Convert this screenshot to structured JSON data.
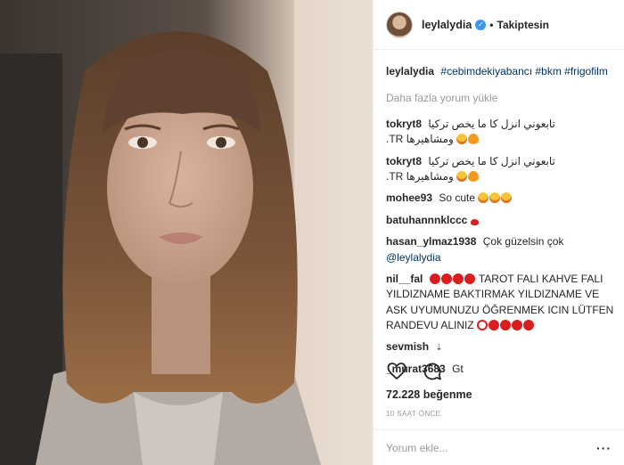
{
  "header": {
    "username": "leylalydia",
    "separator": "•",
    "follow_status": "Takiptesin"
  },
  "caption": {
    "username": "leylalydia",
    "hashtags": [
      "#cebimdekiyabancı",
      "#bkm",
      "#frigofilm"
    ]
  },
  "load_more": "Daha fazla yorum yükle",
  "comments": [
    {
      "user": "tokryt8",
      "text": "تابعوني انزل كا ما يخص تركيا",
      "text2": ".TR ومشاهيرها"
    },
    {
      "user": "tokryt8",
      "text": "تابعوني انزل كا ما يخص تركيا",
      "text2": ".TR ومشاهيرها"
    },
    {
      "user": "mohee93",
      "text": "So cute"
    },
    {
      "user": "batuhannnklccc",
      "text": ""
    },
    {
      "user": "hasan_ylmaz1938",
      "text": "Çok güzelsin çok",
      "mention": "@leylalydia"
    },
    {
      "user": "nil__fal",
      "text": "TAROT FALI KAHVE FALI YILDIZNAME BAKTIRMAK YILDIZNAME VE ASK UYUMUNUZU ÖĞRENMEK ICIN LÜTFEN RANDEVU ALINIZ"
    },
    {
      "user": "sevmish",
      "text": ""
    },
    {
      "user": "_murat3683",
      "text": "Gt"
    }
  ],
  "likes_text": "72.228 beğenme",
  "timestamp": "10 SAAT ÖNCE",
  "add_comment": {
    "placeholder": "Yorum ekle..."
  },
  "more_options": "···",
  "colors": {
    "link": "#003569",
    "verified": "#3897f0",
    "muted": "#999999"
  }
}
